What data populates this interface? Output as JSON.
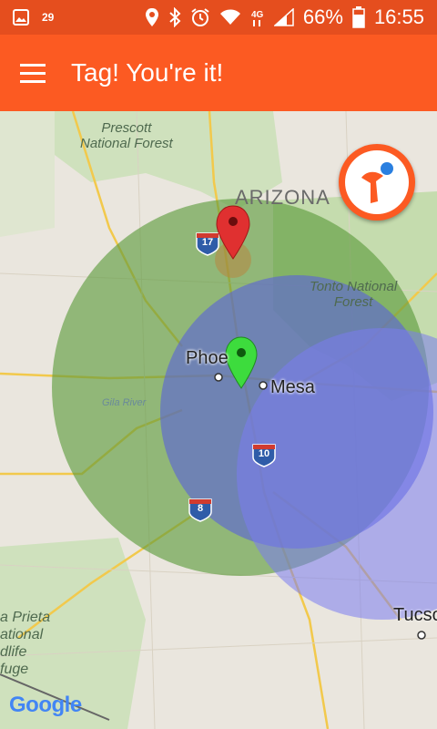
{
  "status_bar": {
    "notification_count": "29",
    "battery_percent": "66%",
    "time": "16:55",
    "network": "4G"
  },
  "app_bar": {
    "title": "Tag! You're it!"
  },
  "map": {
    "state_label": "ARIZONA",
    "forest_prescott": "Prescott\nNational Forest",
    "forest_tonto": "Tonto National\nForest",
    "river": "Gila River",
    "city_phoenix": "Phoe",
    "city_mesa": "Mesa",
    "city_tucson": "Tucso",
    "refuge": "a Prieta\national\ndlife\nfuge",
    "highway_17": "17",
    "highway_10": "10",
    "highway_8": "8",
    "attribution": "Google"
  },
  "colors": {
    "status_bar": "#e54e1e",
    "app_bar": "#fc5a22",
    "player_zone": "#5a9a3a",
    "tagger_zone": "#5b63d8",
    "red_marker": "#e03030",
    "green_marker": "#3ddc3d"
  },
  "icons": [
    "gallery-icon",
    "location-icon",
    "bluetooth-icon",
    "alarm-icon",
    "wifi-icon",
    "signal-icon",
    "battery-icon",
    "menu-icon",
    "app-logo-icon"
  ]
}
